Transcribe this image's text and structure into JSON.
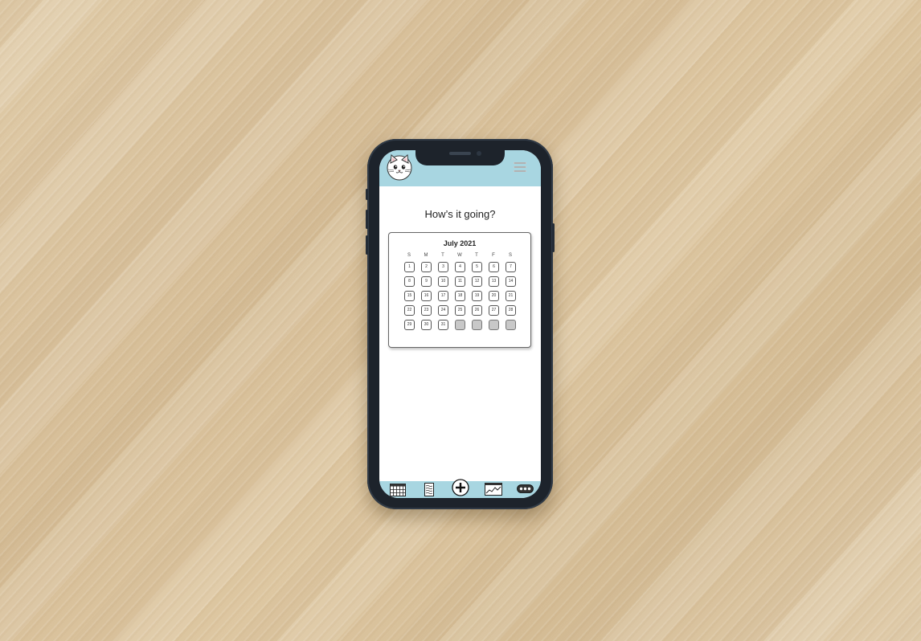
{
  "screen": {
    "greeting": "How’s it going?",
    "accent_color": "#a8d6e1"
  },
  "topbar": {
    "avatar_icon": "cat-avatar-icon",
    "menu_icon": "hamburger-menu-icon"
  },
  "calendar": {
    "month_label": "July 2021",
    "weekdays": [
      "S",
      "M",
      "T",
      "W",
      "T",
      "F",
      "S"
    ],
    "weeks": [
      [
        "1",
        "2",
        "3",
        "4",
        "5",
        "6",
        "7"
      ],
      [
        "8",
        "9",
        "10",
        "11",
        "12",
        "13",
        "14"
      ],
      [
        "15",
        "16",
        "17",
        "18",
        "19",
        "20",
        "21"
      ],
      [
        "22",
        "23",
        "24",
        "25",
        "26",
        "27",
        "28"
      ],
      [
        "29",
        "30",
        "31",
        "",
        "",
        "",
        ""
      ]
    ]
  },
  "bottom_nav": {
    "items": [
      {
        "icon": "calendar-grid-icon"
      },
      {
        "icon": "notes-icon"
      },
      {
        "icon": "add-icon"
      },
      {
        "icon": "chart-icon"
      },
      {
        "icon": "more-icon"
      }
    ]
  }
}
